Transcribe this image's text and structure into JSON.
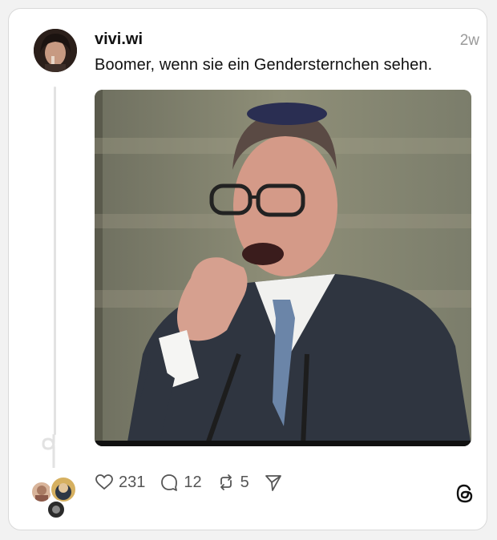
{
  "post": {
    "username": "vivi.wi",
    "time_ago": "2w",
    "text": "Boomer, wenn sie ein Gendersternchen sehen."
  },
  "actions": {
    "likes": "231",
    "comments": "12",
    "reposts": "5"
  },
  "icons": {
    "like": "heart-icon",
    "comment": "comment-icon",
    "repost": "repost-icon",
    "share": "send-icon",
    "brand": "threads-logo-icon"
  }
}
